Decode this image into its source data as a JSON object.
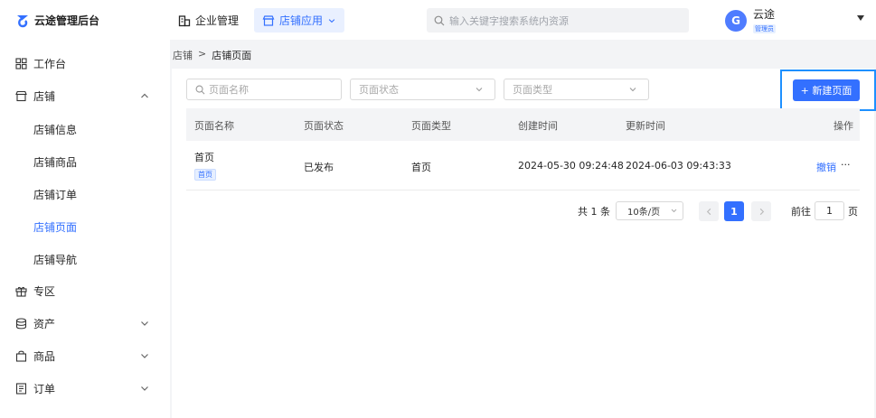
{
  "app": {
    "title": "云途管理后台"
  },
  "topnav": [
    {
      "label": "企业管理"
    },
    {
      "label": "店铺应用"
    }
  ],
  "search": {
    "placeholder": "输入关键字搜索系统内资源"
  },
  "user": {
    "avatar_letter": "G",
    "name": "云途",
    "role": "管理员"
  },
  "sidebar": {
    "items": [
      {
        "label": "工作台"
      },
      {
        "label": "店铺"
      },
      {
        "label": "专区"
      },
      {
        "label": "资产"
      },
      {
        "label": "商品"
      },
      {
        "label": "订单"
      }
    ],
    "store_sub": [
      {
        "label": "店铺信息"
      },
      {
        "label": "店铺商品"
      },
      {
        "label": "店铺订单"
      },
      {
        "label": "店铺页面"
      },
      {
        "label": "店铺导航"
      }
    ]
  },
  "breadcrumb": {
    "parent": "店铺",
    "separator": ">",
    "current": "店铺页面"
  },
  "filters": {
    "name_placeholder": "页面名称",
    "status_placeholder": "页面状态",
    "type_placeholder": "页面类型"
  },
  "new_button": "+ 新建页面",
  "table": {
    "columns": [
      "页面名称",
      "页面状态",
      "页面类型",
      "创建时间",
      "更新时间",
      "操作"
    ],
    "rows": [
      {
        "name": "首页",
        "tag": "首页",
        "status": "已发布",
        "type": "首页",
        "created": "2024-05-30 09:24:48",
        "updated": "2024-06-03 09:43:33",
        "action": "撤销",
        "more": "···"
      }
    ]
  },
  "pagination": {
    "total_text": "共 1 条",
    "page_size": "10条/页",
    "current_page": "1",
    "goto_label": "前往",
    "goto_value": "1",
    "page_unit": "页"
  },
  "colors": {
    "accent": "#3370ff",
    "highlight_border": "#1e90ff"
  }
}
